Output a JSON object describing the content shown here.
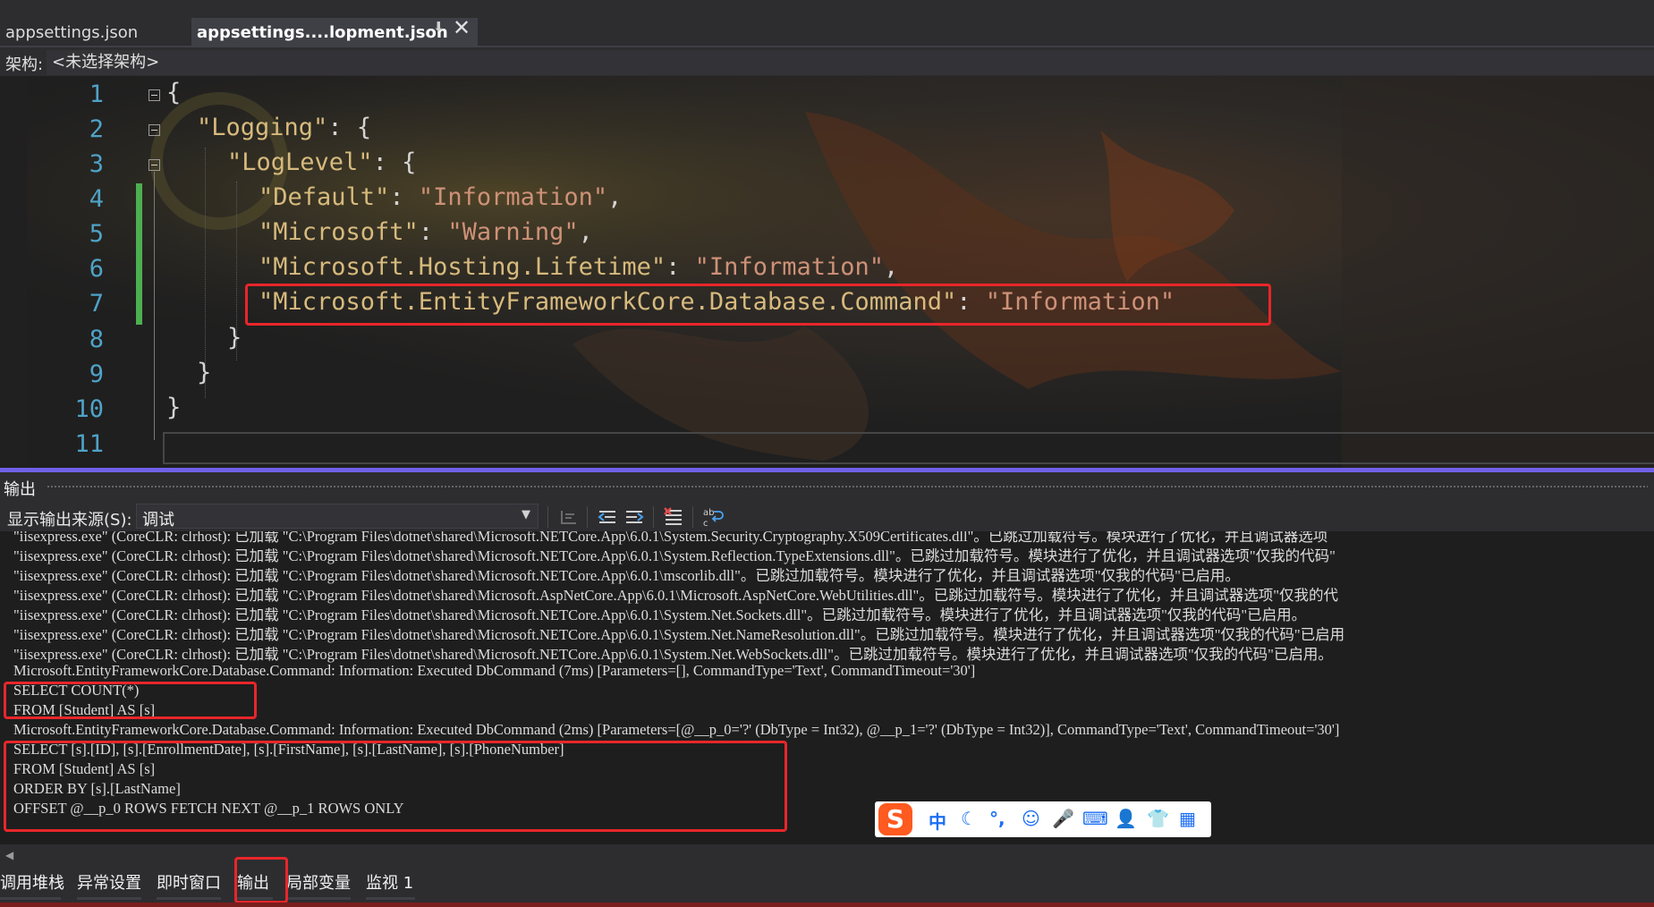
{
  "tabs": [
    {
      "label": "appsettings.json",
      "active": false
    },
    {
      "label": "appsettings....lopment.json",
      "active": true
    }
  ],
  "tab_pin_icon": "pin-icon",
  "tab_close_icon": "close-icon",
  "architecture": {
    "label": "架构:",
    "value": "<未选择架构>"
  },
  "editor": {
    "line_numbers": [
      "1",
      "2",
      "3",
      "4",
      "5",
      "6",
      "7",
      "8",
      "9",
      "10",
      "11"
    ],
    "lines": [
      {
        "parts": [
          {
            "t": "p",
            "v": "{"
          }
        ]
      },
      {
        "parts": [
          {
            "t": "k",
            "v": "\"Logging\""
          },
          {
            "t": "p",
            "v": ": {"
          }
        ]
      },
      {
        "parts": [
          {
            "t": "k",
            "v": "\"LogLevel\""
          },
          {
            "t": "p",
            "v": ": {"
          }
        ]
      },
      {
        "parts": [
          {
            "t": "k",
            "v": "\"Default\""
          },
          {
            "t": "p",
            "v": ": "
          },
          {
            "t": "s",
            "v": "\"Information\""
          },
          {
            "t": "p",
            "v": ","
          }
        ]
      },
      {
        "parts": [
          {
            "t": "k",
            "v": "\"Microsoft\""
          },
          {
            "t": "p",
            "v": ": "
          },
          {
            "t": "s",
            "v": "\"Warning\""
          },
          {
            "t": "p",
            "v": ","
          }
        ]
      },
      {
        "parts": [
          {
            "t": "k",
            "v": "\"Microsoft.Hosting.Lifetime\""
          },
          {
            "t": "p",
            "v": ": "
          },
          {
            "t": "s",
            "v": "\"Information\""
          },
          {
            "t": "p",
            "v": ","
          }
        ]
      },
      {
        "parts": [
          {
            "t": "k",
            "v": "\"Microsoft.EntityFrameworkCore.Database.Command\""
          },
          {
            "t": "p",
            "v": ": "
          },
          {
            "t": "s",
            "v": "\"Information\""
          }
        ]
      },
      {
        "parts": [
          {
            "t": "p",
            "v": "}"
          }
        ]
      },
      {
        "parts": [
          {
            "t": "p",
            "v": "}"
          }
        ]
      },
      {
        "parts": [
          {
            "t": "p",
            "v": "}"
          }
        ]
      },
      {
        "parts": []
      }
    ],
    "colors": {
      "key": "#d7ba7d",
      "string": "#ce9178",
      "line_number": "#4fa3c7",
      "change_bar": "#4caf50",
      "highlight": "#e8262a"
    }
  },
  "output": {
    "title": "输出",
    "source_label": "显示输出来源(S):",
    "source_value": "调试",
    "toolbar_icons": [
      "go-to-previous-message-icon",
      "find-previous-icon",
      "find-next-icon",
      "clear-all-icon",
      "toggle-word-wrap-icon"
    ],
    "lines": [
      "\"iisexpress.exe\" (CoreCLR: clrhost): 已加载 \"C:\\Program Files\\dotnet\\shared\\Microsoft.NETCore.App\\6.0.1\\System.Security.Cryptography.X509Certificates.dll\"。已跳过加载符号。模块进行了优化，并且调试器选项",
      "\"iisexpress.exe\" (CoreCLR: clrhost): 已加载 \"C:\\Program Files\\dotnet\\shared\\Microsoft.NETCore.App\\6.0.1\\System.Reflection.TypeExtensions.dll\"。已跳过加载符号。模块进行了优化，并且调试器选项\"仅我的代码\"",
      "\"iisexpress.exe\" (CoreCLR: clrhost): 已加载 \"C:\\Program Files\\dotnet\\shared\\Microsoft.NETCore.App\\6.0.1\\mscorlib.dll\"。已跳过加载符号。模块进行了优化，并且调试器选项\"仅我的代码\"已启用。",
      "\"iisexpress.exe\" (CoreCLR: clrhost): 已加载 \"C:\\Program Files\\dotnet\\shared\\Microsoft.AspNetCore.App\\6.0.1\\Microsoft.AspNetCore.WebUtilities.dll\"。已跳过加载符号。模块进行了优化，并且调试器选项\"仅我的代",
      "\"iisexpress.exe\" (CoreCLR: clrhost): 已加载 \"C:\\Program Files\\dotnet\\shared\\Microsoft.NETCore.App\\6.0.1\\System.Net.Sockets.dll\"。已跳过加载符号。模块进行了优化，并且调试器选项\"仅我的代码\"已启用。",
      "\"iisexpress.exe\" (CoreCLR: clrhost): 已加载 \"C:\\Program Files\\dotnet\\shared\\Microsoft.NETCore.App\\6.0.1\\System.Net.NameResolution.dll\"。已跳过加载符号。模块进行了优化，并且调试器选项\"仅我的代码\"已启用",
      "\"iisexpress.exe\" (CoreCLR: clrhost): 已加载 \"C:\\Program Files\\dotnet\\shared\\Microsoft.NETCore.App\\6.0.1\\System.Net.WebSockets.dll\"。已跳过加载符号。模块进行了优化，并且调试器选项\"仅我的代码\"已启用。",
      "Microsoft.EntityFrameworkCore.Database.Command: Information: Executed DbCommand (7ms) [Parameters=[], CommandType='Text', CommandTimeout='30']",
      "SELECT COUNT(*)",
      "FROM [Student] AS [s]",
      "Microsoft.EntityFrameworkCore.Database.Command: Information: Executed DbCommand (2ms) [Parameters=[@__p_0='?' (DbType = Int32), @__p_1='?' (DbType = Int32)], CommandType='Text', CommandTimeout='30']",
      "SELECT [s].[ID], [s].[EnrollmentDate], [s].[FirstName], [s].[LastName], [s].[PhoneNumber]",
      "FROM [Student] AS [s]",
      "ORDER BY [s].[LastName]",
      "OFFSET @__p_0 ROWS FETCH NEXT @__p_1 ROWS ONLY"
    ]
  },
  "ime": {
    "logo": "S",
    "items": [
      {
        "icon": "chinese-mode-icon",
        "glyph": "中"
      },
      {
        "icon": "moon-icon",
        "glyph": "☾"
      },
      {
        "icon": "punctuation-icon",
        "glyph": "°,"
      },
      {
        "icon": "emoji-icon",
        "glyph": "☺"
      },
      {
        "icon": "microphone-icon",
        "glyph": "🎤"
      },
      {
        "icon": "keyboard-icon",
        "glyph": "⌨"
      },
      {
        "icon": "user-icon",
        "glyph": "👤"
      },
      {
        "icon": "shirt-icon",
        "glyph": "👕"
      },
      {
        "icon": "apps-grid-icon",
        "glyph": "▦"
      }
    ]
  },
  "bottom_tabs": [
    {
      "label": "调用堆栈"
    },
    {
      "label": "异常设置"
    },
    {
      "label": "即时窗口"
    },
    {
      "label": "输出",
      "active": true
    },
    {
      "label": "局部变量"
    },
    {
      "label": "监视 1"
    }
  ]
}
